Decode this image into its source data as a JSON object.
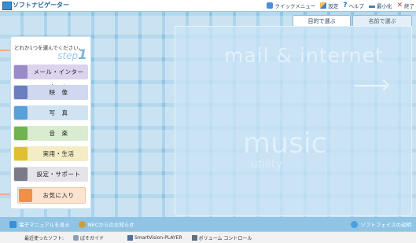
{
  "window": {
    "title": "ソフトナビゲーター"
  },
  "toolbar": {
    "quick_menu": "クイックメニュー",
    "settings": "設定",
    "help": "ヘルプ",
    "minimize": "最小化",
    "exit": "終了"
  },
  "tabs": {
    "by_purpose": "目的で選ぶ",
    "by_name": "名前で選ぶ"
  },
  "menu": {
    "prompt": "どれか1つを選んでください。",
    "step_word": "step",
    "step_number": "1",
    "items": [
      {
        "label": "メール・インターネット",
        "icon": "mail-internet-icon"
      },
      {
        "label": "映　像",
        "icon": "video-icon"
      },
      {
        "label": "写　真",
        "icon": "photo-icon"
      },
      {
        "label": "音　楽",
        "icon": "music-icon"
      },
      {
        "label": "実用・生活",
        "icon": "practical-life-icon"
      },
      {
        "label": "設定・サポート",
        "icon": "settings-support-icon"
      }
    ],
    "favorites": {
      "label": "お気に入り",
      "icon": "favorites-star-icon"
    }
  },
  "panel": {
    "watermark_top": "mail & internet",
    "watermark_music": "music",
    "watermark_utility": "utility"
  },
  "bottom": {
    "manual": "電子マニュアルを見る",
    "nec_news": "NECからのお知らせ",
    "softface": "ソフトフェイスの説明"
  },
  "statusbar": {
    "recent_label": "最近使ったソフト:",
    "items": [
      "ぱそガイド",
      "SmartVision-PLAYER",
      "ボリューム コントロール"
    ]
  },
  "colors": {
    "background": "#8fc4e4",
    "accent_line": "#f2a98f",
    "title_text": "#1f5f99"
  }
}
